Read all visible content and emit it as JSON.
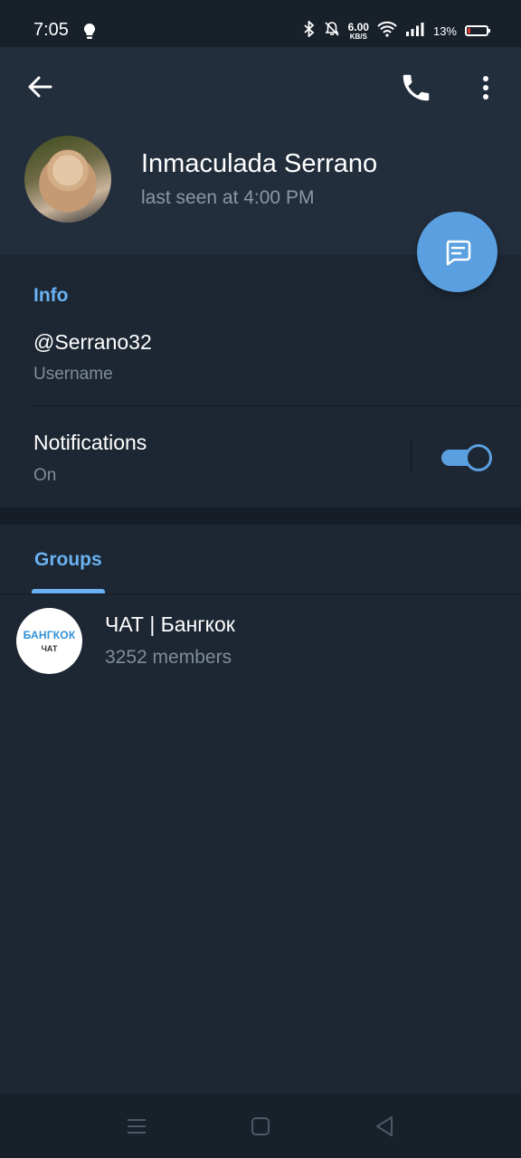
{
  "status_bar": {
    "time": "7:05",
    "speed_value": "6.00",
    "speed_unit": "KB/S",
    "battery_percent": "13%",
    "icons": [
      "lightbulb-icon",
      "bluetooth-icon",
      "bell-off-icon",
      "wifi-icon",
      "signal-icon",
      "battery-icon"
    ]
  },
  "header": {
    "name": "Inmaculada Serrano",
    "last_seen": "last seen at 4:00 PM",
    "icons": [
      "back-arrow-icon",
      "phone-icon",
      "more-vert-icon",
      "message-icon"
    ]
  },
  "info": {
    "section_title": "Info",
    "username": "@Serrano32",
    "username_label": "Username",
    "notifications_title": "Notifications",
    "notifications_status": "On",
    "notifications_enabled": true
  },
  "tabs": [
    {
      "label": "Groups",
      "selected": true
    }
  ],
  "groups": [
    {
      "avatar_line1": "БАНГКОК",
      "avatar_line2": "ЧАТ",
      "name": "ЧАТ | Бангкок",
      "members": "3252 members"
    }
  ],
  "nav_bar": {
    "icons": [
      "menu-icon",
      "home-icon",
      "back-triangle-icon"
    ]
  },
  "colors": {
    "accent": "#6ab2f2",
    "fab": "#5a9fe0",
    "background": "#1d2733",
    "header_bg": "#232e3c",
    "secondary_text": "#7f8c99",
    "battery_low": "#e53935"
  }
}
